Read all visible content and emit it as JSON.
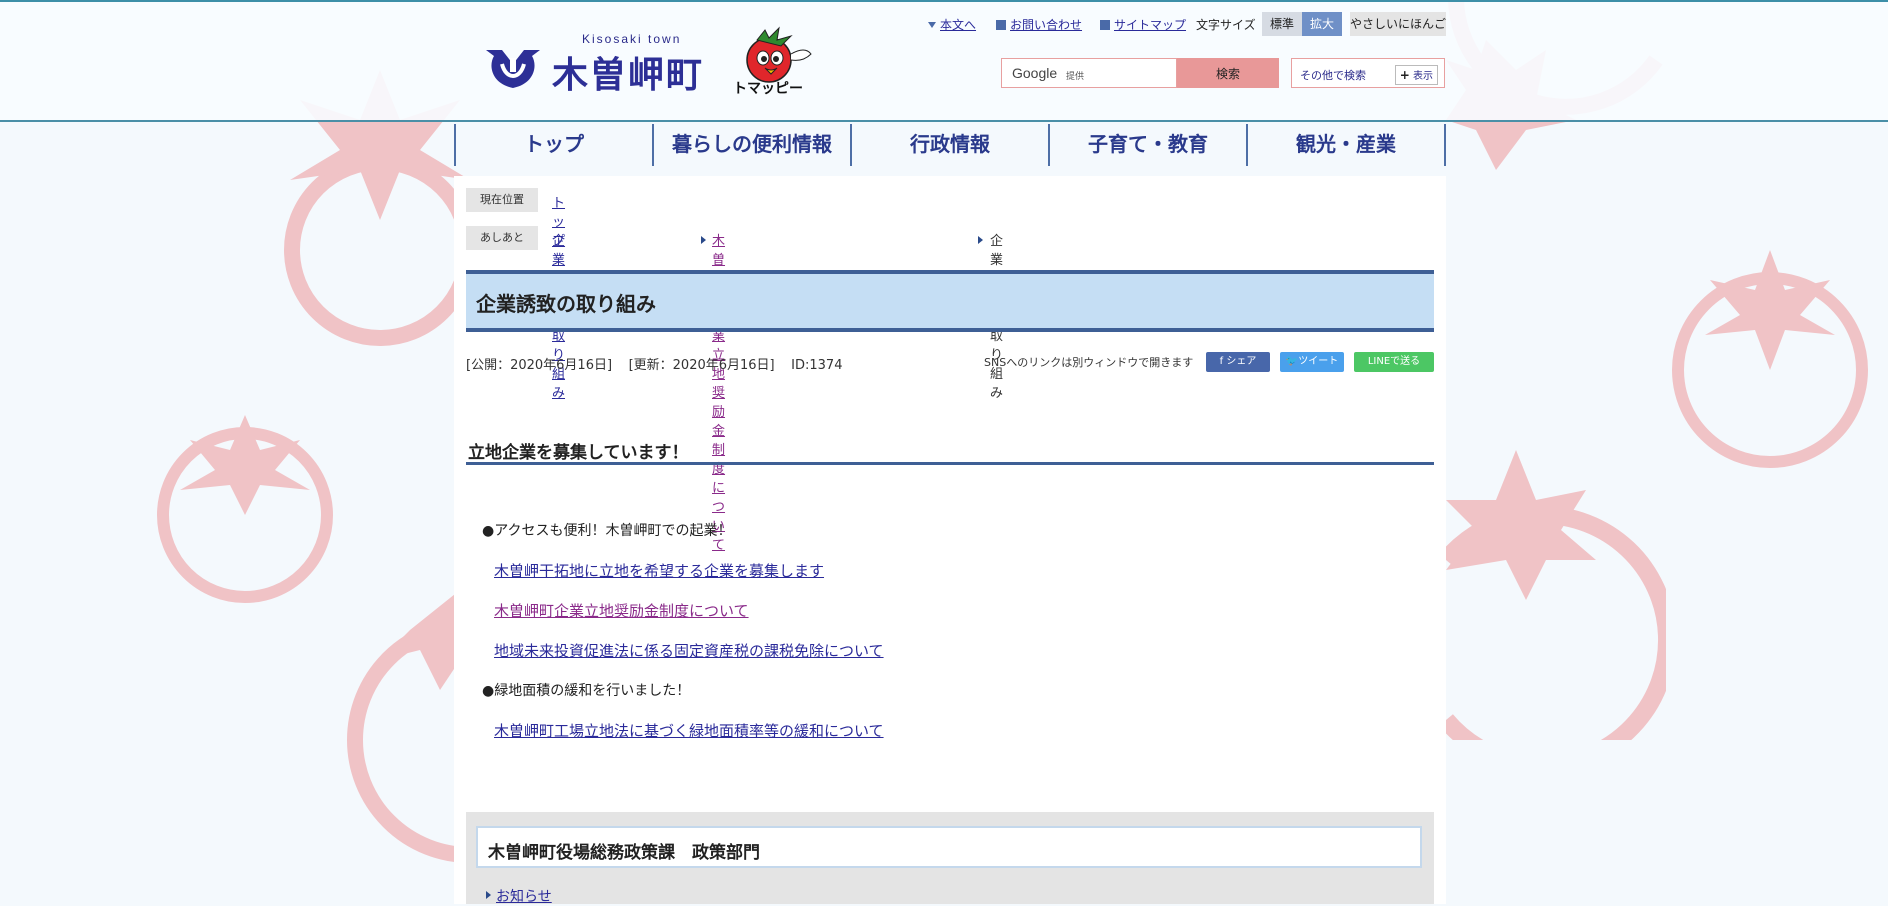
{
  "header": {
    "logo_sub": "Kisosaki town",
    "logo_title": "木曽岬町",
    "mascot_name": "トマッピー",
    "util": {
      "honbun": "本文へ",
      "contact": "お問い合わせ",
      "sitemap": "サイトマップ",
      "fontsize_label": "文字サイズ",
      "fs_standard": "標準",
      "fs_large": "拡大",
      "yasashii": "やさしいにほんご"
    },
    "search": {
      "google": "Google",
      "provided": "提供",
      "button": "検索",
      "other": "その他で検索",
      "show": "表示"
    }
  },
  "nav": [
    "トップ",
    "暮らしの便利情報",
    "行政情報",
    "子育て・教育",
    "観光・産業"
  ],
  "breadcrumb": {
    "current_label": "現在位置",
    "current_link": "トップ",
    "history_label": "あしあと",
    "history": [
      "企業誘致の取り組み",
      "木曽岬町企業立地奨励金制度について",
      "企業誘致の取り組み"
    ]
  },
  "page": {
    "title": "企業誘致の取り組み",
    "published": "[公開：2020年6月16日]",
    "updated": "[更新：2020年6月16日]",
    "id": "ID:1374",
    "sns_note": "SNSへのリンクは別ウィンドウで開きます",
    "sns_fb": "シェア",
    "sns_tw": "ツイート",
    "sns_line": "LINEで送る"
  },
  "section": {
    "heading": "立地企業を募集しています！",
    "bullet1": "●アクセスも便利！木曽岬町での起業！",
    "links1": [
      "木曽岬干拓地に立地を希望する企業を募集します",
      "木曽岬町企業立地奨励金制度について",
      "地域未来投資促進法に係る固定資産税の課税免除について"
    ],
    "bullet2": "●緑地面積の緩和を行いました！",
    "links2": [
      "木曽岬町工場立地法に基づく緑地面積率等の緩和について"
    ]
  },
  "contact": {
    "title": "木曽岬町役場総務政策課　政策部門",
    "link": "お知らせ"
  },
  "colors": {
    "nav_border": "#4e6fa6",
    "title_bg": "#c5def4",
    "tomato": "#f0c3c6"
  }
}
